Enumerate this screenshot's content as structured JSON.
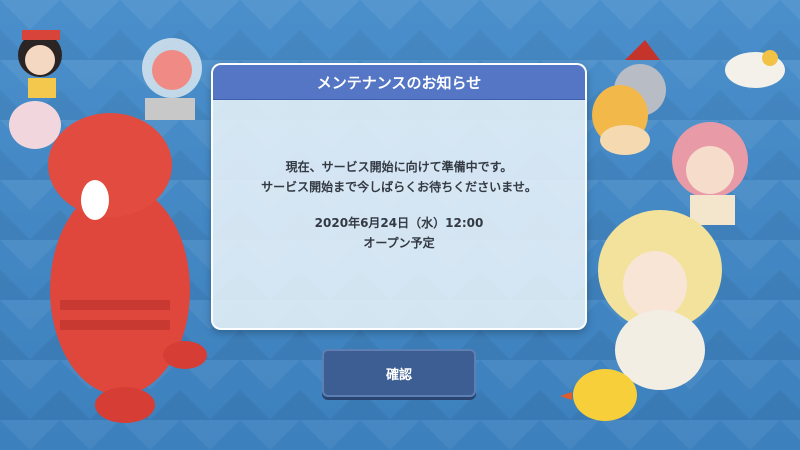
{
  "notice": {
    "title": "メンテナンスのお知らせ",
    "line1": "現在、サービス開始に向けて準備中です。",
    "line2": "サービス開始まで今しばらくお待ちくださいませ。",
    "datetime": "2020年6月24日（水）12:00",
    "status": "オープン予定"
  },
  "confirm_button": {
    "label": "確認"
  },
  "colors": {
    "background": "#3f86c4",
    "header": "#5476c4",
    "button": "#3d5e93"
  }
}
